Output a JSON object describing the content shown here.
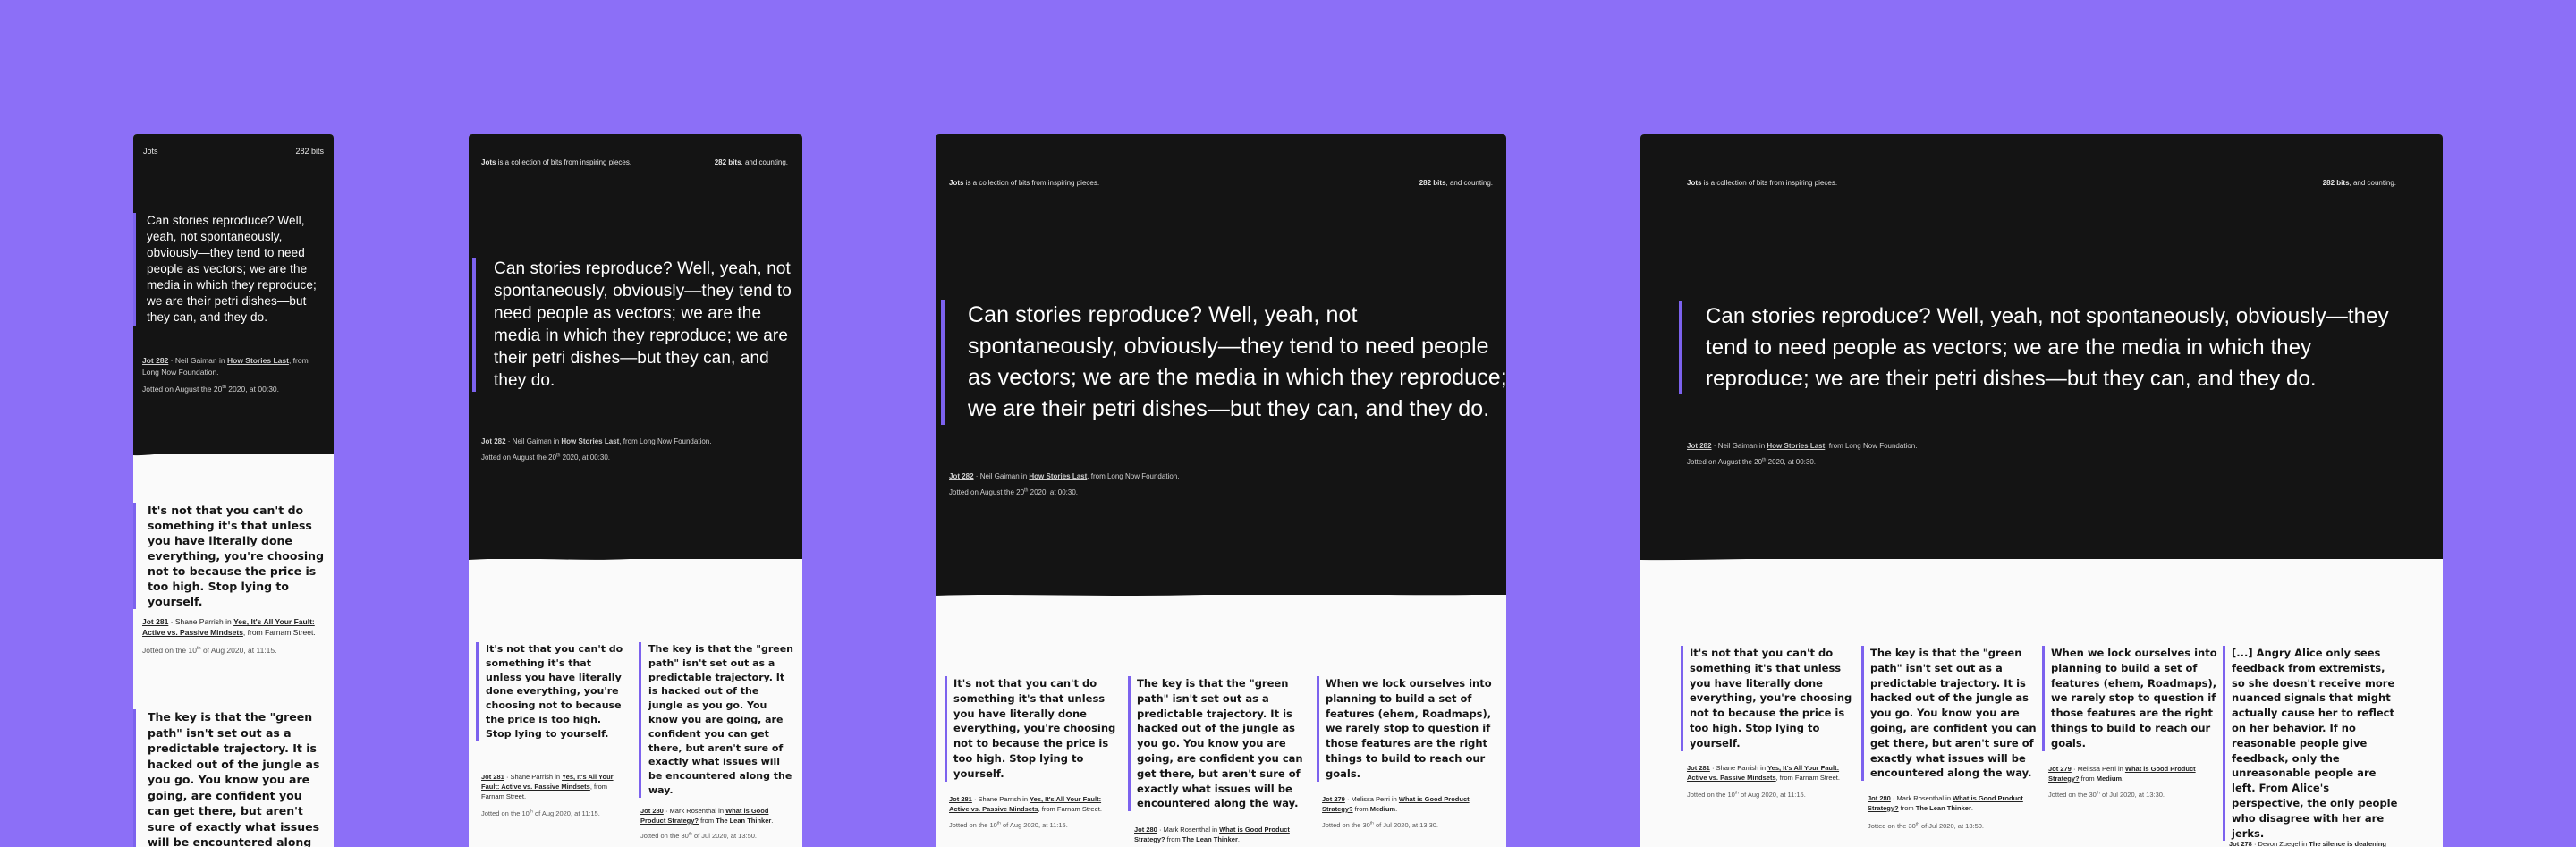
{
  "site": {
    "short_title": "Jots",
    "title_bold": "Jots",
    "title_rest": " is a collection of bits from inspiring pieces.",
    "count_short": "282 bits",
    "count_bold": "282 bits",
    "count_rest": ", and counting."
  },
  "featured": {
    "quote": "Can stories reproduce? Well, yeah, not spontaneously, obviously—they tend to need people as vectors; we are the media in which they reproduce; we are their petri dishes—but they can, and they do.",
    "jot_label": "Jot 282",
    "author": "Neil Gaiman",
    "in_word": " in ",
    "piece": "How Stories Last",
    "from_word": ", from ",
    "source": "Long Now Foundation",
    "jotted_prefix": "Jotted on August the 20",
    "jotted_sup": "th",
    "jotted_suffix": " 2020, at 00:30."
  },
  "jots": [
    {
      "quote": "It's not that you can't do something it's that unless you have literally done everything, you're choosing not to because the price is too high. Stop lying to yourself.",
      "jot_label": "Jot 281",
      "author": "Shane Parrish",
      "piece": "Yes, It's All Your Fault: Active vs. Passive Mindsets",
      "source": "Farnam Street",
      "date_prefix": "Jotted on the 10",
      "date_sup": "th",
      "date_suffix": " of Aug 2020, at 11:15."
    },
    {
      "quote": "The key is that the \"green path\" isn't set out as a predictable trajectory. It is hacked out of the jungle as you go. You know you are going, are confident you can get there, but aren't sure of exactly what issues will be encountered along the way.",
      "jot_label": "Jot 280",
      "author": "Mark Rosenthal",
      "piece": "What is Good Product Strategy?",
      "source": "The Lean Thinker",
      "date_prefix": "Jotted on the 30",
      "date_sup": "th",
      "date_suffix": " of Jul 2020, at 13:50."
    },
    {
      "quote": "When we lock ourselves into planning to build a set of features (ehem, Roadmaps), we rarely stop to question if those features are the right things to build to reach our goals.",
      "jot_label": "Jot 279",
      "author": "Melissa Perri",
      "piece": "What is Good Product Strategy?",
      "source": "Medium",
      "date_prefix": "Jotted on the 30",
      "date_sup": "th",
      "date_suffix": " of Jul 2020, at 13:30."
    },
    {
      "quote": "[...] Angry Alice only sees feedback from extremists, so she doesn't receive more nuanced signals that might actually cause her to reflect on her behavior. If no reasonable people give feedback, only the unreasonable people are left. From Alice's perspective, the only people who disagree with her are jerks.",
      "jot_label": "Jot 278",
      "author": "Devon Zuegel",
      "piece": "The silence is deafening"
    }
  ],
  "colors": {
    "background": "#8c6ff7",
    "dark": "#141414",
    "light": "#fafafa",
    "accent": "#7c62ee"
  }
}
